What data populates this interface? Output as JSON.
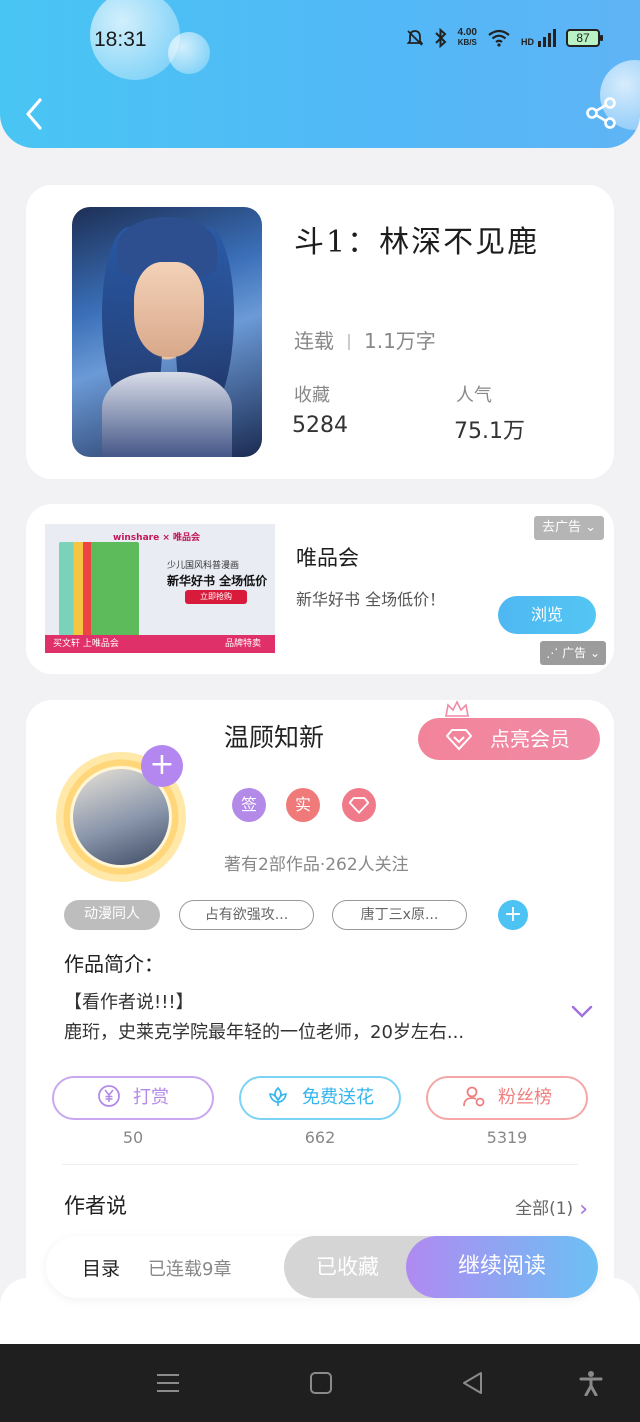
{
  "status_bar": {
    "time": "18:31",
    "net_speed_value": "4.00",
    "net_speed_unit": "KB/S",
    "signal_label": "HD",
    "battery": "87"
  },
  "header": {
    "colors": {
      "gradient_start": "#49c5f3",
      "gradient_end": "#5fb4f5"
    },
    "icons": {
      "back": "chevron-left-icon",
      "share": "share-icon"
    }
  },
  "book": {
    "title": "斗1：林深不见鹿",
    "status": "连载",
    "word_count": "1.1万字",
    "collect_label": "收藏",
    "collect_value": "5284",
    "popularity_label": "人气",
    "popularity_value": "75.1万"
  },
  "ad": {
    "image": {
      "brand": "winshare × 唯品会",
      "line1": "少儿国风科普漫画",
      "line2": "新华好书 全场低价",
      "cta": "立即抢购",
      "bottom_left": "买文轩 上唯品会",
      "bottom_right": "品牌特卖"
    },
    "title": "唯品会",
    "description": "新华好书 全场低价！",
    "remove_label": "去广告",
    "browse_label": "浏览",
    "tag_label": "广告"
  },
  "author": {
    "name": "温顾知新",
    "vip_label": "点亮会员",
    "badges": [
      {
        "label": "签",
        "color": "#b48ae8"
      },
      {
        "label": "实",
        "color": "#f07a7a"
      },
      {
        "label": "",
        "color": "#f07a8a"
      }
    ],
    "meta": "著有2部作品·262人关注",
    "tags": [
      "动漫同人",
      "占有欲强攻...",
      "唐丁三x原..."
    ],
    "intro_label": "作品简介：",
    "intro_line1": "【看作者说!!!】",
    "intro_line2": "鹿珩，史莱克学院最年轻的一位老师，20岁左右...",
    "actions": [
      {
        "label": "打赏",
        "count": "50",
        "color": "#b48ae8"
      },
      {
        "label": "免费送花",
        "count": "662",
        "color": "#4cc3f2"
      },
      {
        "label": "粉丝榜",
        "count": "5319",
        "color": "#f08080"
      }
    ],
    "author_says_label": "作者说",
    "all_label": "全部(1)"
  },
  "reader_bar": {
    "toc_label": "目录",
    "chapter_info": "已连载9章",
    "collected_label": "已收藏",
    "continue_label": "继续阅读"
  }
}
